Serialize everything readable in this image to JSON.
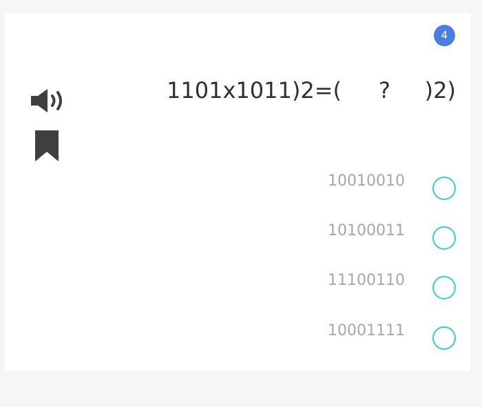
{
  "question_number": "4",
  "question": {
    "prefix": "1101x1011)2=(",
    "blank": "?",
    "suffix": ")2)"
  },
  "options": [
    {
      "label": "10010010"
    },
    {
      "label": "10100011"
    },
    {
      "label": "11100110"
    },
    {
      "label": "10001111"
    }
  ],
  "icons": {
    "audio": "speaker-icon",
    "bookmark": "bookmark-icon"
  },
  "colors": {
    "badge": "#4a7de0",
    "radio_border": "#3cc7d5",
    "option_text": "#a6a6a6",
    "question_text": "#2f2f2f",
    "icon": "#3f3f3f"
  }
}
